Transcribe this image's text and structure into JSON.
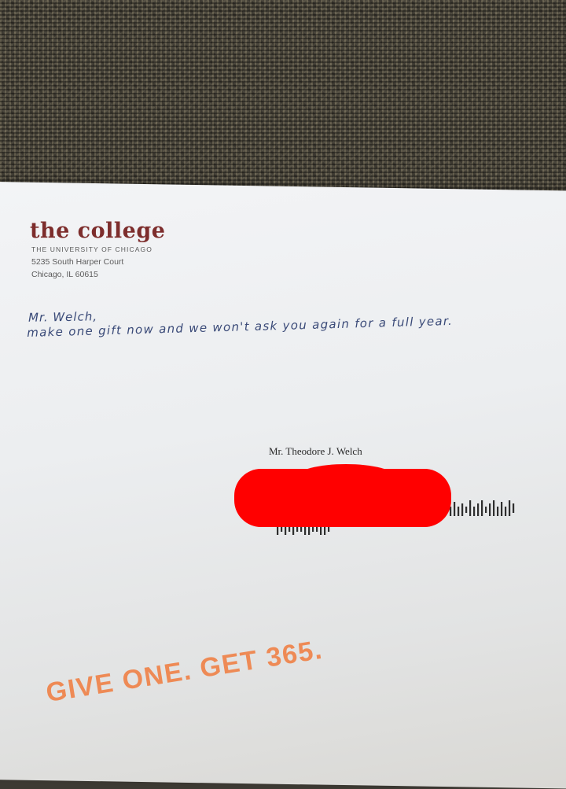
{
  "envelope": {
    "sender": {
      "logo": "the college",
      "institution": "THE UNIVERSITY OF CHICAGO",
      "street": "5235 South Harper Court",
      "city": "Chicago, IL 60615"
    },
    "handwritten_note": {
      "line1": "Mr. Welch,",
      "line2": "make one gift now and we won't ask you again for a full year."
    },
    "recipient": {
      "name": "Mr. Theodore J. Welch"
    },
    "slogan": "GIVE ONE. GET 365.",
    "colors": {
      "logo": "#7d2d2c",
      "ink": "#3a4a78",
      "slogan": "#ee8a55",
      "redaction": "#ff0000"
    }
  }
}
